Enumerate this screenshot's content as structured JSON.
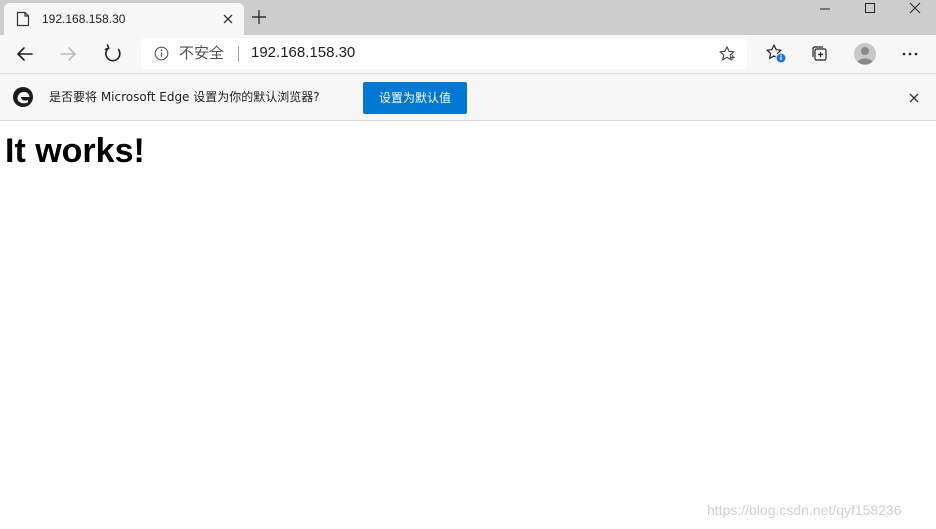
{
  "tab": {
    "title": "192.168.158.30",
    "favicon": "page-icon",
    "close_icon": "close-icon"
  },
  "new_tab_icon": "plus-icon",
  "window_controls": {
    "minimize_icon": "minimize-icon",
    "maximize_icon": "maximize-icon",
    "close_icon": "close-icon"
  },
  "toolbar": {
    "back_icon": "arrow-left-icon",
    "forward_icon": "arrow-right-icon",
    "refresh_icon": "refresh-icon",
    "omnibox": {
      "info_icon": "info-icon",
      "security_label": "不安全",
      "url": "192.168.158.30",
      "favorite_icon": "star-icon"
    },
    "favorites_icon": "favorites-star-icon",
    "collections_icon": "collections-icon",
    "profile_icon": "avatar-icon",
    "more_icon": "ellipsis-icon"
  },
  "infobar": {
    "logo": "edge-logo-icon",
    "message": "是否要将 Microsoft Edge 设置为你的默认浏览器?",
    "button_label": "设置为默认值",
    "close_icon": "close-icon"
  },
  "page": {
    "heading": "It works!"
  },
  "watermark": "https://blog.csdn.net/qyf158236",
  "colors": {
    "tabstrip": "#cdcdcd",
    "toolbar": "#f7f7f7",
    "accent": "#0078d4",
    "badge": "#1a73e8"
  }
}
